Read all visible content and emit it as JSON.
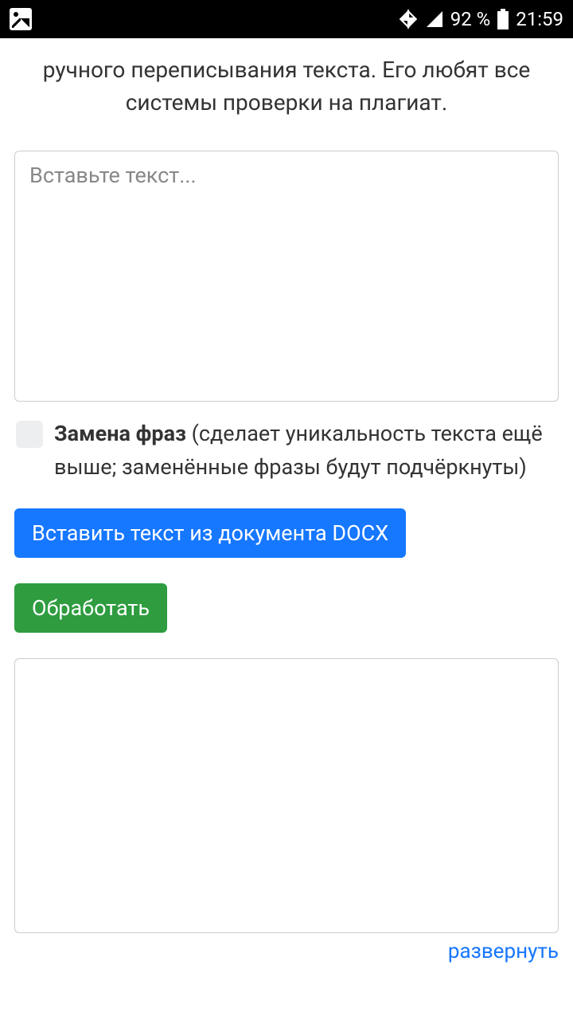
{
  "status_bar": {
    "battery_percent": "92 %",
    "time": "21:59"
  },
  "intro": "ручного переписывания текста. Его любят все системы проверки на плагиат.",
  "input": {
    "placeholder": "Вставьте текст..."
  },
  "checkbox": {
    "bold": "Замена фраз",
    "rest": " (сделает уникальность текста ещё выше; заменённые фразы будут подчёркнуты)"
  },
  "buttons": {
    "insert_docx": "Вставить текст из документа DOCX",
    "process": "Обработать"
  },
  "expand": "развернуть"
}
